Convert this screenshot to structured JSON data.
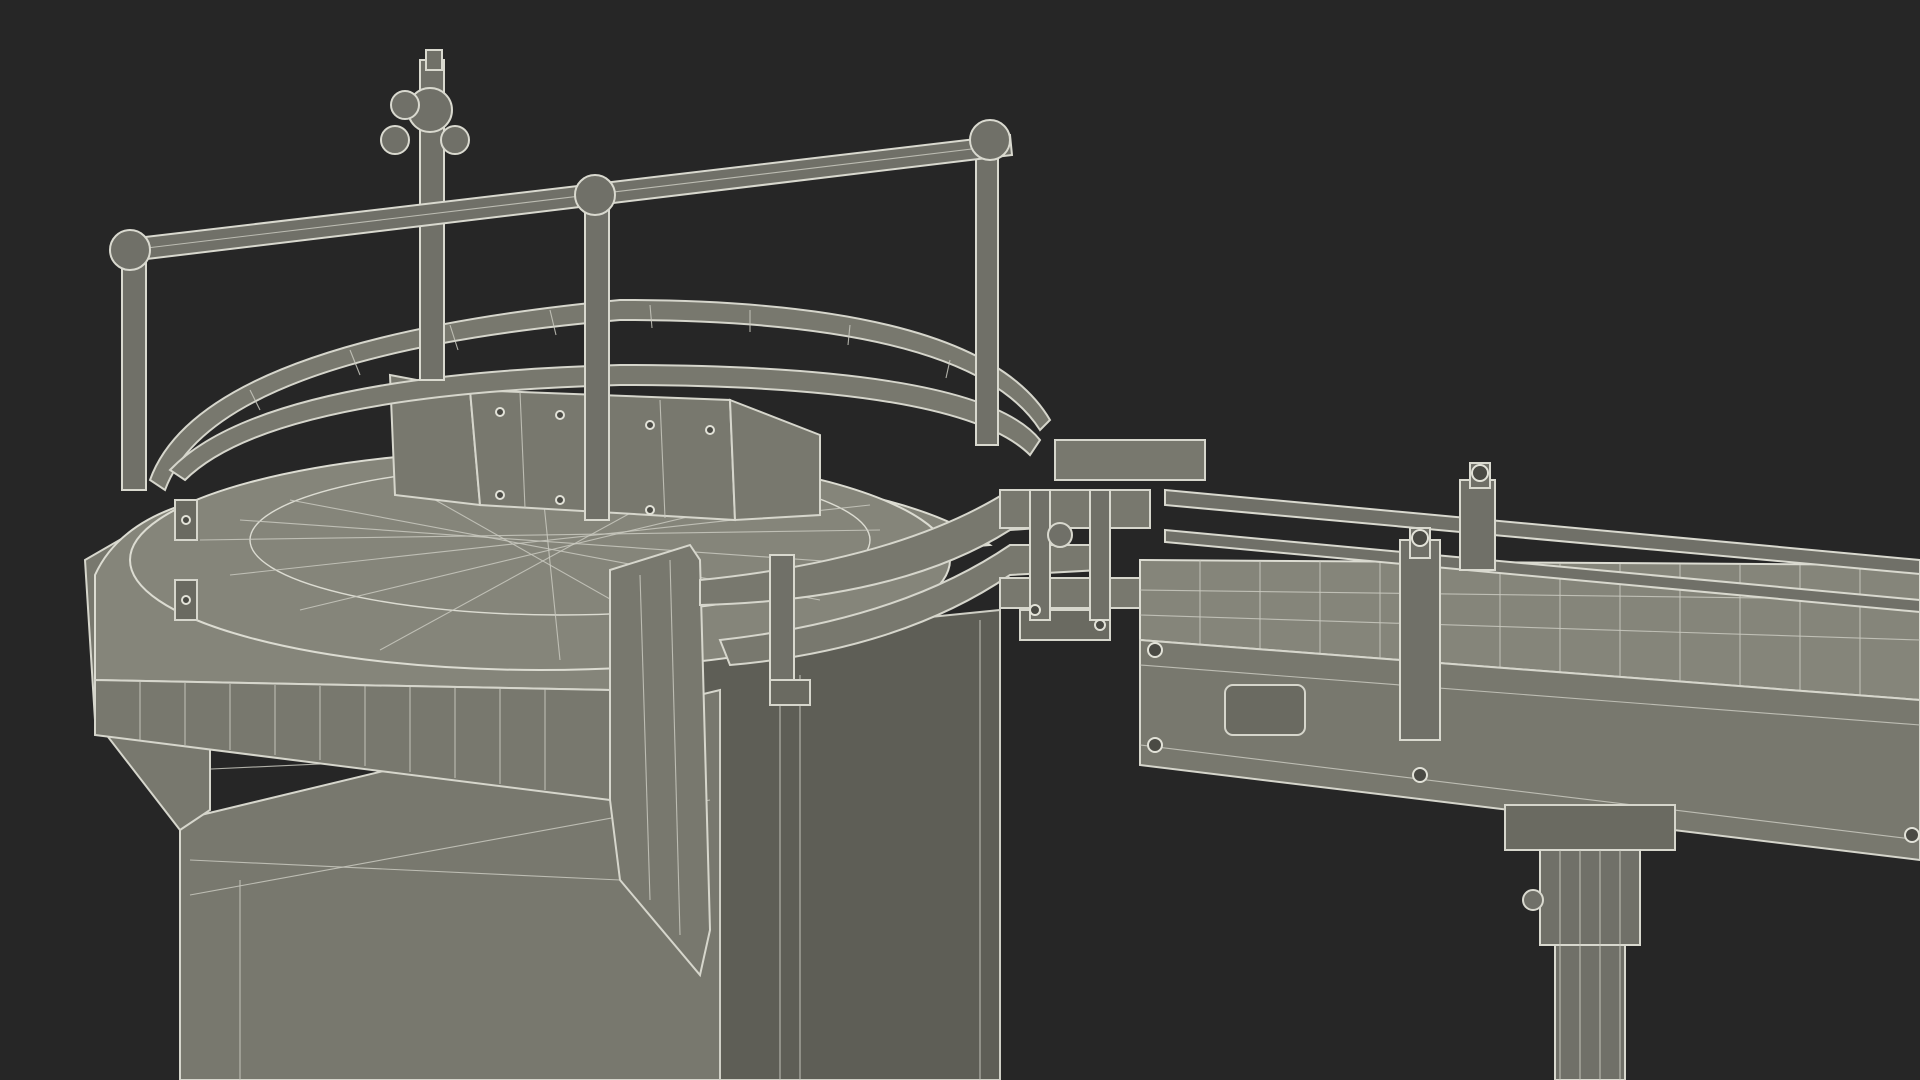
{
  "scene": {
    "background_color": "#262626",
    "object_fill": "#78786e",
    "wire_color": "#d6d6cc"
  }
}
